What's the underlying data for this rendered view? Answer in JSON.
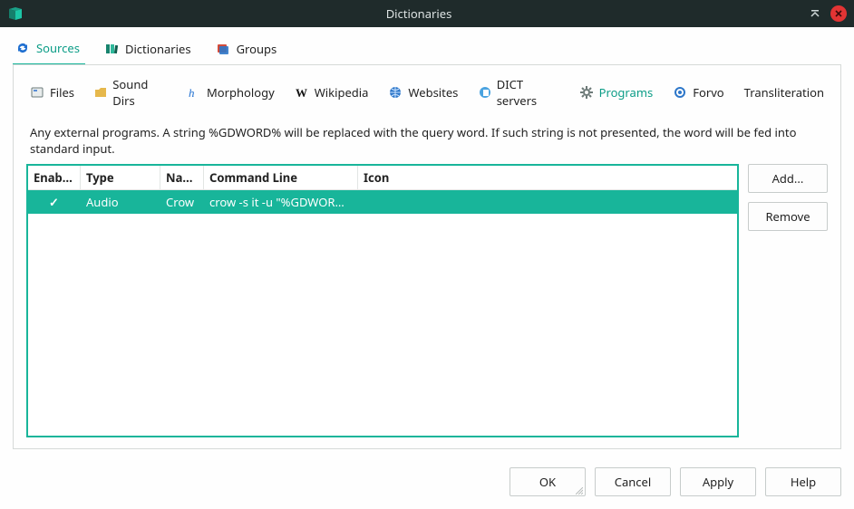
{
  "window": {
    "title": "Dictionaries"
  },
  "main_tabs": [
    {
      "label": "Sources",
      "active": true
    },
    {
      "label": "Dictionaries",
      "active": false
    },
    {
      "label": "Groups",
      "active": false
    }
  ],
  "sub_tabs": [
    {
      "label": "Files"
    },
    {
      "label": "Sound Dirs"
    },
    {
      "label": "Morphology"
    },
    {
      "label": "Wikipedia"
    },
    {
      "label": "Websites"
    },
    {
      "label": "DICT servers"
    },
    {
      "label": "Programs",
      "active": true
    },
    {
      "label": "Forvo"
    },
    {
      "label": "Transliteration"
    }
  ],
  "description": "Any external programs. A string %GDWORD% will be replaced with the query word. If such string is not presented, the word will be fed into standard input.",
  "table": {
    "headers": {
      "enabled": "Enabled",
      "type": "Type",
      "name": "Name",
      "command": "Command Line",
      "icon": "Icon"
    },
    "rows": [
      {
        "enabled": true,
        "type": "Audio",
        "name": "Crow",
        "command": "crow -s it -u \"%GDWORD%\"",
        "icon": ""
      }
    ]
  },
  "side_buttons": {
    "add": "Add...",
    "remove": "Remove"
  },
  "dialog_buttons": {
    "ok": "OK",
    "cancel": "Cancel",
    "apply": "Apply",
    "help": "Help"
  }
}
